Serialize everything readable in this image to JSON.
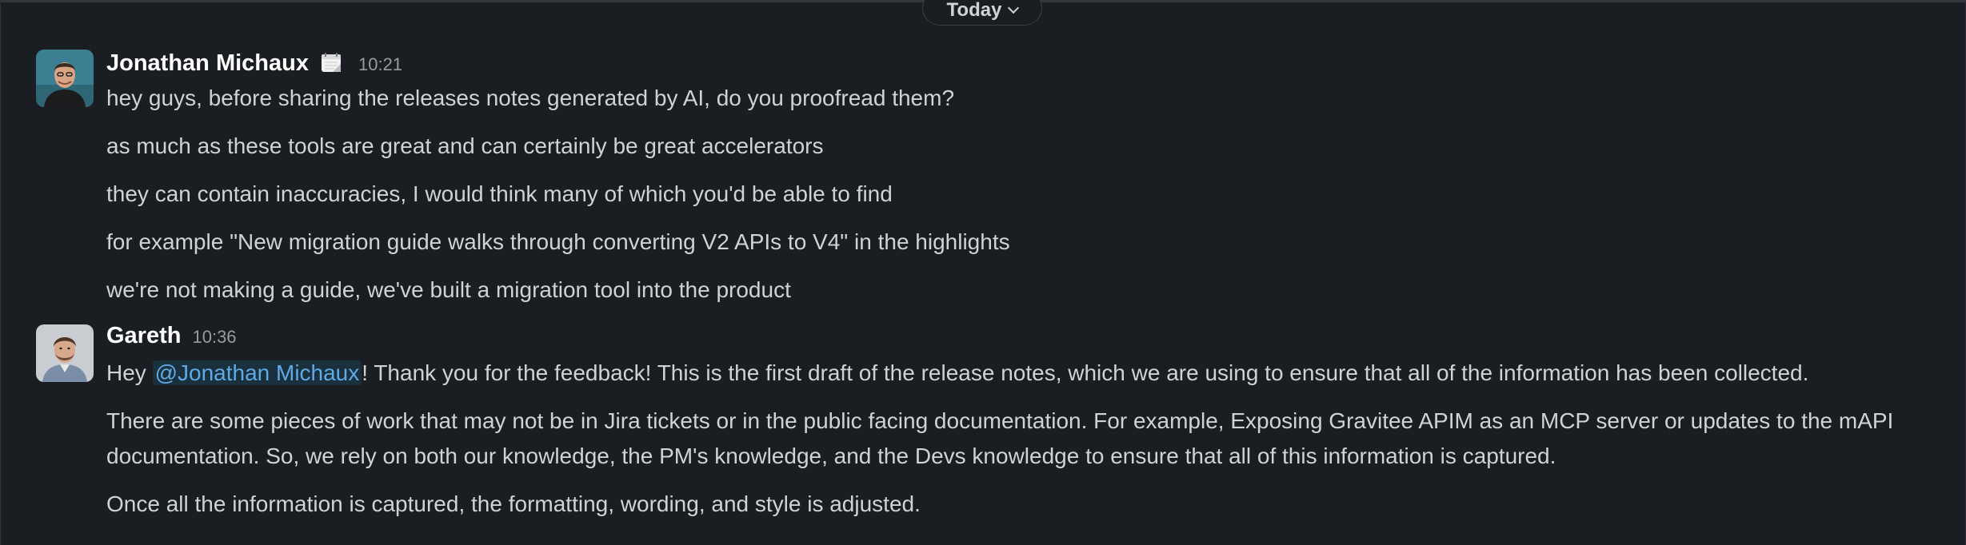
{
  "divider": {
    "label": "Today"
  },
  "messages": [
    {
      "author": "Jonathan Michaux",
      "status_icon": "calendar-icon",
      "time": "10:21",
      "lines": [
        "hey guys, before sharing the releases notes generated by AI, do you proofread them?",
        "as much as these tools are great and can certainly be great accelerators",
        "they can contain inaccuracies, I would think many of which you'd be able to find",
        "for example \"New migration guide walks through converting V2 APIs to V4\" in the highlights",
        "we're not making a guide, we've built a migration tool into the product"
      ]
    },
    {
      "author": "Gareth",
      "time": "10:36",
      "first_line": {
        "prefix": "Hey ",
        "mention": "@Jonathan Michaux",
        "suffix": "! Thank you for the feedback! This is the first draft of the release notes, which we are using to ensure that all of the information has been collected."
      },
      "lines": [
        "There are some pieces of work that may not be in Jira tickets or in the public facing documentation. For example, Exposing Gravitee APIM as an MCP server or updates to the mAPI documentation. So, we rely on both our knowledge, the PM's knowledge, and the Devs knowledge to ensure that all of this information is captured.",
        "Once all the information is captured, the formatting, wording, and style is adjusted."
      ]
    }
  ],
  "colors": {
    "background": "#1a1d21",
    "text": "#d1d2d3",
    "mention": "#5fa9e6"
  }
}
